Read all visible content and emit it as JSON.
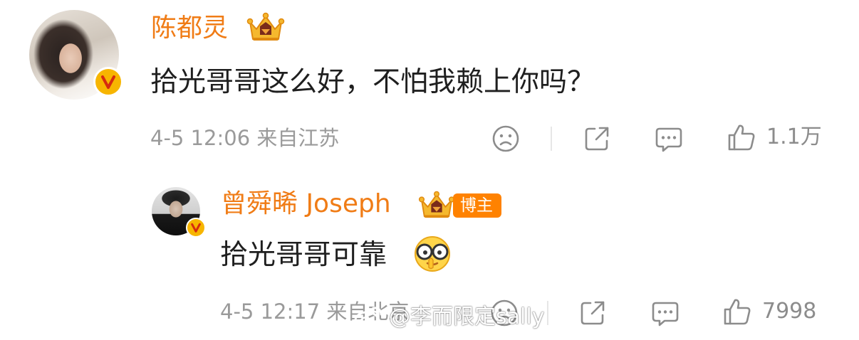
{
  "comment": {
    "username": "陈都灵",
    "text": "拾光哥哥这么好，不怕我赖上你吗？",
    "meta": "4-5 12:06 来自江苏",
    "likes": "1.1万",
    "verified_color": "#f7b500",
    "username_color": "#f07c16"
  },
  "reply": {
    "username": "曾舜晞 Joseph",
    "badge": "博主",
    "text": "拾光哥哥可靠",
    "emoji": "glasses-emoji",
    "meta": "4-5 12:17 来自北京",
    "likes": "7998"
  },
  "watermark": {
    "text": "@李而限定sally",
    "icon": "weibo-logo-icon"
  },
  "icons": {
    "dislike": "sad-face-icon",
    "share": "share-icon",
    "comment": "comment-bubble-icon",
    "like": "thumbs-up-icon",
    "crown": "crown-badge-icon",
    "verified": "verified-v-icon"
  },
  "colors": {
    "accent": "#ff8200",
    "meta_gray": "#9a9a9a",
    "text": "#1f1f1f"
  }
}
